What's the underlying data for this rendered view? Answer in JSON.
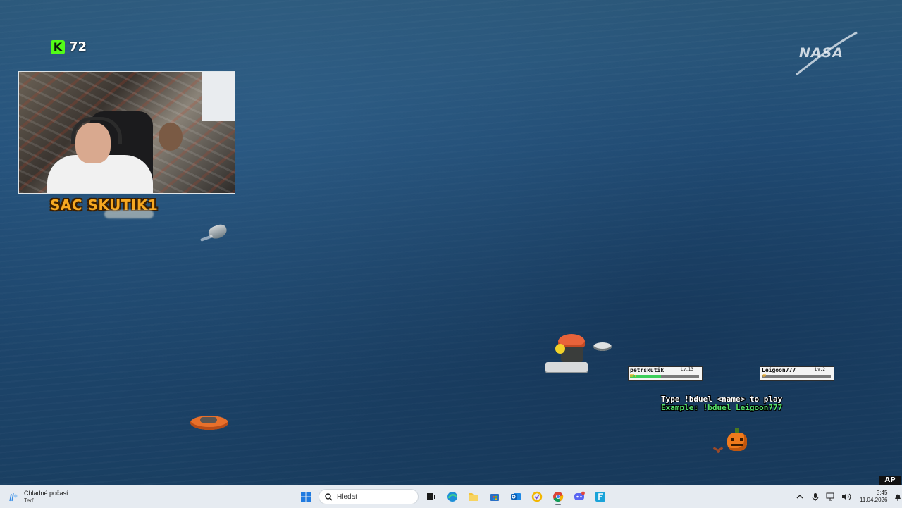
{
  "stream": {
    "viewer_count": "72",
    "streamer_name": "SAC SKUTIK1",
    "broadcaster_logo": "NASA"
  },
  "duel": {
    "player1": {
      "name": "petrskutik",
      "level": "Lv.13",
      "hp_label": "HP:",
      "hp_fraction": 0.45
    },
    "player2": {
      "name": "Leigoon777",
      "level": "Lv.2",
      "hp_label": "HP:",
      "hp_fraction": 0.0
    },
    "instruction": "Type !bduel <name> to play",
    "example": "Example: !bduel Leigoon777"
  },
  "corner_badge": "AP",
  "taskbar": {
    "weather_title": "Chladné počasí",
    "weather_subtitle": "Teď",
    "search_placeholder": "Hledat",
    "clock_time": "3:45",
    "clock_date": "11.04.2026",
    "apps": [
      "start-icon",
      "task-view-icon",
      "edge-icon",
      "file-explorer-icon",
      "store-icon",
      "outlook-icon",
      "norton-icon",
      "chrome-icon",
      "discord-icon",
      "app-f-icon"
    ]
  },
  "colors": {
    "kick_green": "#53fc18",
    "streamer_orange": "#f6a821",
    "duel_green": "#56e36b",
    "hp_green": "#3ccf5a"
  }
}
